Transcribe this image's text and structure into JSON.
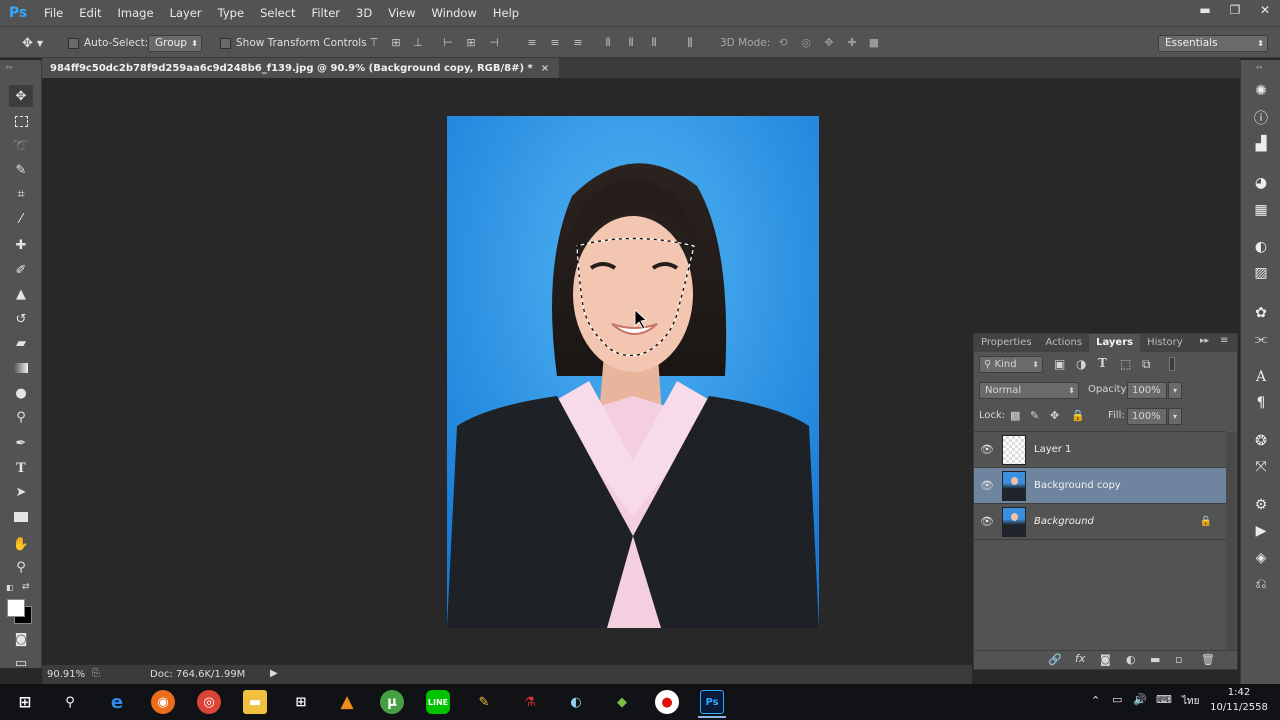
{
  "app": {
    "logo": "Ps",
    "brand_color": "#31a8ff"
  },
  "menu": [
    "File",
    "Edit",
    "Image",
    "Layer",
    "Type",
    "Select",
    "Filter",
    "3D",
    "View",
    "Window",
    "Help"
  ],
  "window_controls": {
    "minimize": "▬",
    "restore": "❐",
    "close": "✕"
  },
  "options_bar": {
    "auto_select_label": "Auto-Select:",
    "auto_select_target": "Group",
    "show_transform_label": "Show Transform Controls",
    "mode_3d_label": "3D Mode:",
    "workspace": "Essentials"
  },
  "document": {
    "tab_title": "984ff9c50dc2b78f9d259aa6c9d248b6_f139.jpg @ 90.9% (Background copy, RGB/8#) *",
    "tab_close": "×",
    "zoom": "90.91%",
    "doc_info": "Doc: 764.6K/1.99M"
  },
  "panel": {
    "tabs": [
      "Properties",
      "Actions",
      "Layers",
      "History"
    ],
    "active_tab": "Layers",
    "filter_kind": "Kind",
    "blend_mode": "Normal",
    "opacity_label": "Opacity:",
    "opacity_value": "100%",
    "lock_label": "Lock:",
    "fill_label": "Fill:",
    "fill_value": "100%",
    "layers": [
      {
        "name": "Layer 1",
        "selected": false,
        "locked": false
      },
      {
        "name": "Background copy",
        "selected": true,
        "locked": false
      },
      {
        "name": "Background",
        "selected": false,
        "locked": true
      }
    ]
  },
  "taskbar": {
    "time": "1:42",
    "date": "10/11/2558",
    "language": "ไทย"
  }
}
